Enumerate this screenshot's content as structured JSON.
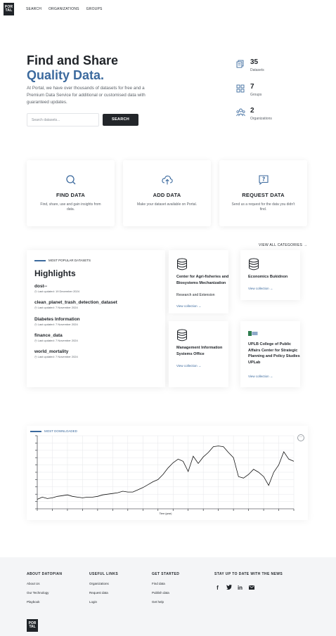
{
  "nav": {
    "logo": "POR TAL",
    "links": [
      "SEARCH",
      "ORGANIZATIONS",
      "GROUPS"
    ]
  },
  "hero": {
    "title_line1": "Find and Share",
    "title_line2": "Quality Data.",
    "description": "At Portal, we have over thousands of datasets for free and a Premium Data Service for additional or customised data with guaranteed updates.",
    "search_placeholder": "Search datasets...",
    "search_button": "SEARCH",
    "accent_color": "#3c6a9e"
  },
  "stats": [
    {
      "value": "35",
      "label": "Datasets",
      "icon": "datasets-icon"
    },
    {
      "value": "7",
      "label": "Groups",
      "icon": "groups-icon"
    },
    {
      "value": "2",
      "label": "Organizations",
      "icon": "organizations-icon"
    }
  ],
  "actions": [
    {
      "title": "FIND DATA",
      "desc": "Find, share, use and gain insights from data.",
      "icon": "search-icon"
    },
    {
      "title": "ADD DATA",
      "desc": "Make your dataset available on Portal.",
      "icon": "cloud-upload-icon"
    },
    {
      "title": "REQUEST DATA",
      "desc": "Send us a request for the data you didn't find.",
      "icon": "request-question-icon"
    }
  ],
  "view_all": "VIEW ALL CATEGORIES →",
  "highlights": {
    "tag": "MOST POPULAR DATASETS",
    "title": "Highlights",
    "items": [
      {
        "name": "dost--",
        "date": "Last updated: 19 December 2024"
      },
      {
        "name": "clean_planet_trash_detection_dataset",
        "date": "Last updated: 7 November 2024"
      },
      {
        "name": "Diabetes Information",
        "date": "Last updated: 7 November 2024"
      },
      {
        "name": "finance_data",
        "date": "Last updated: 7 November 2024"
      },
      {
        "name": "world_mortality",
        "date": "Last updated: 7 November 2024"
      }
    ]
  },
  "categories": [
    {
      "name": "Center for Agri-fisheries and Biosystems Mechanization",
      "sub": "Research and Extension",
      "link": "View collection →",
      "icon": "database-icon"
    },
    {
      "name": "Economics Bukidnon",
      "sub": "",
      "link": "View collection →",
      "icon": "database-icon"
    },
    {
      "name": "Management Information Systems Office",
      "sub": "",
      "link": "View collection →",
      "icon": "database-icon"
    },
    {
      "name": "UPLB College of Public Affairs Center for Strategic Planning and Policy Studies UPLab",
      "sub": "",
      "link": "View collection →",
      "icon": "logo-image-icon"
    }
  ],
  "downloads_tag": "MOST DOWNLOADED",
  "chart_data": {
    "type": "line",
    "title": "",
    "xlabel": "Time (year)",
    "ylabel": "",
    "y": [
      13,
      16,
      14,
      15,
      17,
      18,
      19,
      17,
      16,
      15,
      16,
      16,
      17,
      19,
      20,
      21,
      22,
      24,
      23,
      23,
      26,
      29,
      33,
      37,
      40,
      47,
      56,
      63,
      68,
      65,
      51,
      72,
      62,
      71,
      77,
      85,
      86,
      85,
      77,
      70,
      44,
      42,
      47,
      54,
      50,
      44,
      32,
      50,
      60,
      78,
      68,
      65
    ],
    "ylim": [
      0,
      100
    ],
    "grid": true
  },
  "footer": {
    "columns": [
      {
        "head": "ABOUT DATOPIAN",
        "links": [
          "About Us",
          "Our Technology",
          "Playbook"
        ]
      },
      {
        "head": "USEFUL LINKS",
        "links": [
          "Organizations",
          "Request data",
          "Login"
        ]
      },
      {
        "head": "GET STARTED",
        "links": [
          "Find data",
          "Publish data",
          "Get help"
        ]
      }
    ],
    "news_head": "STAY UP TO DATE WITH THE NEWS",
    "socials": [
      "facebook-icon",
      "twitter-icon",
      "linkedin-icon",
      "email-icon"
    ],
    "logo": "POR TAL"
  }
}
